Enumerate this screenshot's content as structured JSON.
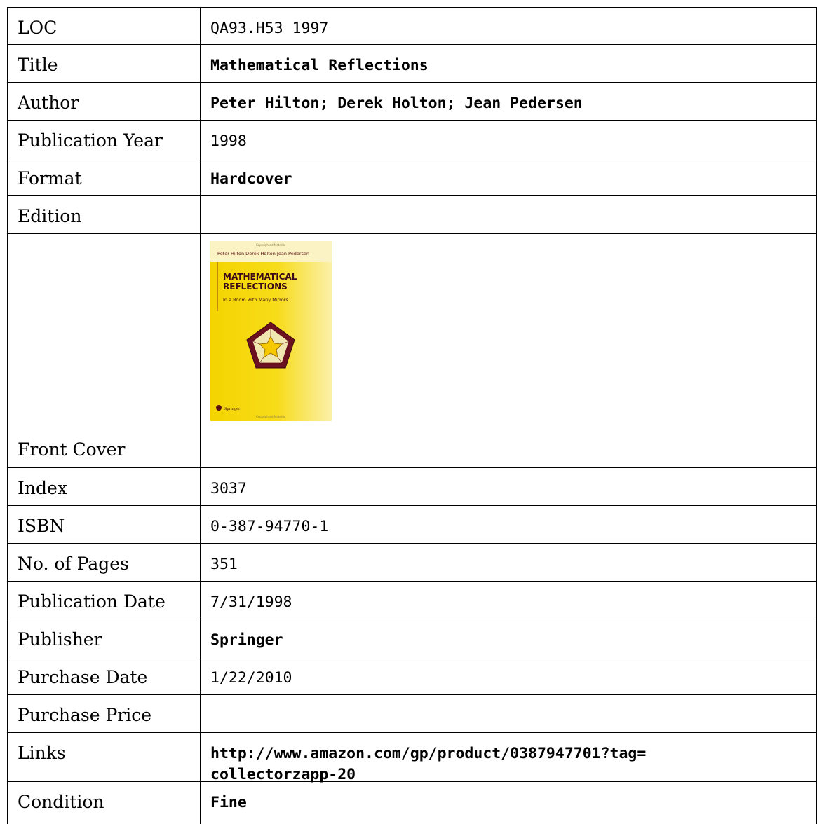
{
  "record": {
    "loc": {
      "label": "LOC",
      "value": "QA93.H53 1997"
    },
    "title": {
      "label": "Title",
      "value": "Mathematical Reflections"
    },
    "author": {
      "label": "Author",
      "value": "Peter Hilton; Derek Holton; Jean Pedersen"
    },
    "publication_year": {
      "label": "Publication Year",
      "value": "1998"
    },
    "format": {
      "label": "Format",
      "value": "Hardcover"
    },
    "edition": {
      "label": "Edition",
      "value": ""
    },
    "front_cover": {
      "label": "Front Cover",
      "image": {
        "authors": "Peter Hilton  Derek Holton  Jean Pedersen",
        "title_line1": "MATHEMATICAL",
        "title_line2": "REFLECTIONS",
        "subtitle": "In a Room with Many Mirrors",
        "publisher": "Springer",
        "copyright_top": "Copyrighted Material",
        "copyright_bottom": "Copyrighted Material"
      }
    },
    "index": {
      "label": "Index",
      "value": "3037"
    },
    "isbn": {
      "label": "ISBN",
      "value": "0-387-94770-1"
    },
    "pages": {
      "label": "No. of Pages",
      "value": "351"
    },
    "publication_date": {
      "label": "Publication Date",
      "value": "7/31/1998"
    },
    "publisher": {
      "label": "Publisher",
      "value": "Springer"
    },
    "purchase_date": {
      "label": "Purchase Date",
      "value": "1/22/2010"
    },
    "purchase_price": {
      "label": "Purchase Price",
      "value": ""
    },
    "links": {
      "label": "Links",
      "value_line1": "http://www.amazon.com/gp/product/0387947701?tag=",
      "value_line2": "collectorzapp-20"
    },
    "condition": {
      "label": "Condition",
      "value": "Fine"
    }
  }
}
